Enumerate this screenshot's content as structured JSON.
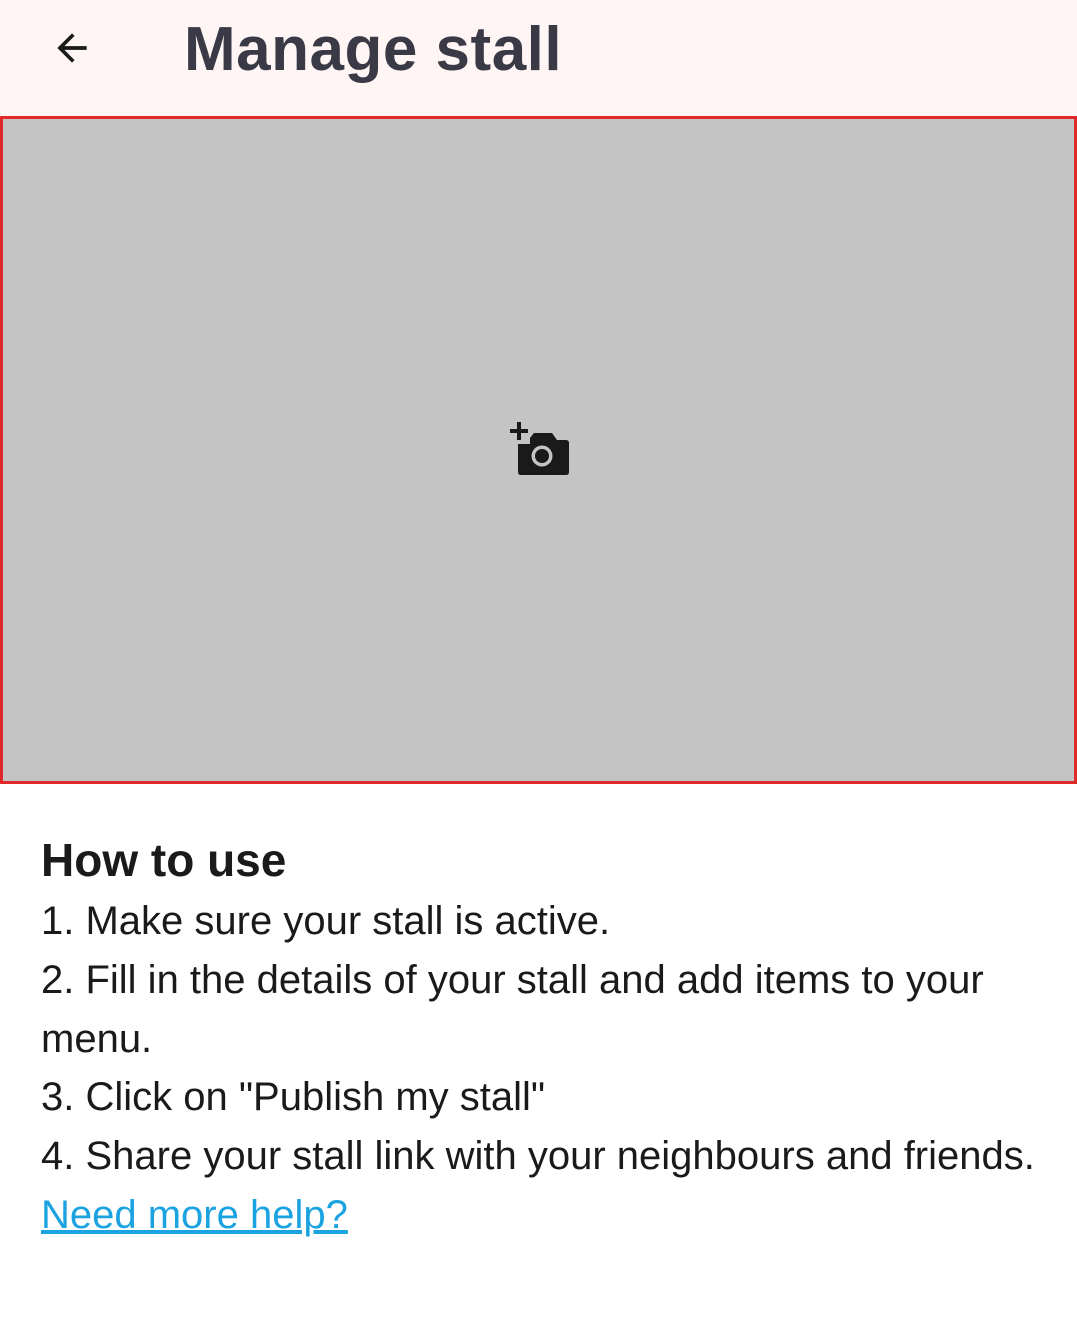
{
  "header": {
    "back_icon": "arrow-left-icon",
    "title": "Manage stall",
    "background": "#fff5f4",
    "title_color": "#3a3a46"
  },
  "photo": {
    "icon": "add-photo-camera-icon",
    "background": "#c4c4c4",
    "border_color": "#e02a2a"
  },
  "howto": {
    "title": "How to use",
    "steps": [
      "1. Make sure your stall is active.",
      "2. Fill in the details of your stall and add items to your menu.",
      "3. Click on \"Publish my stall\"",
      "4. Share your stall link with your neighbours and friends."
    ],
    "help_link": "Need more help?",
    "link_color": "#1aa3e0"
  }
}
